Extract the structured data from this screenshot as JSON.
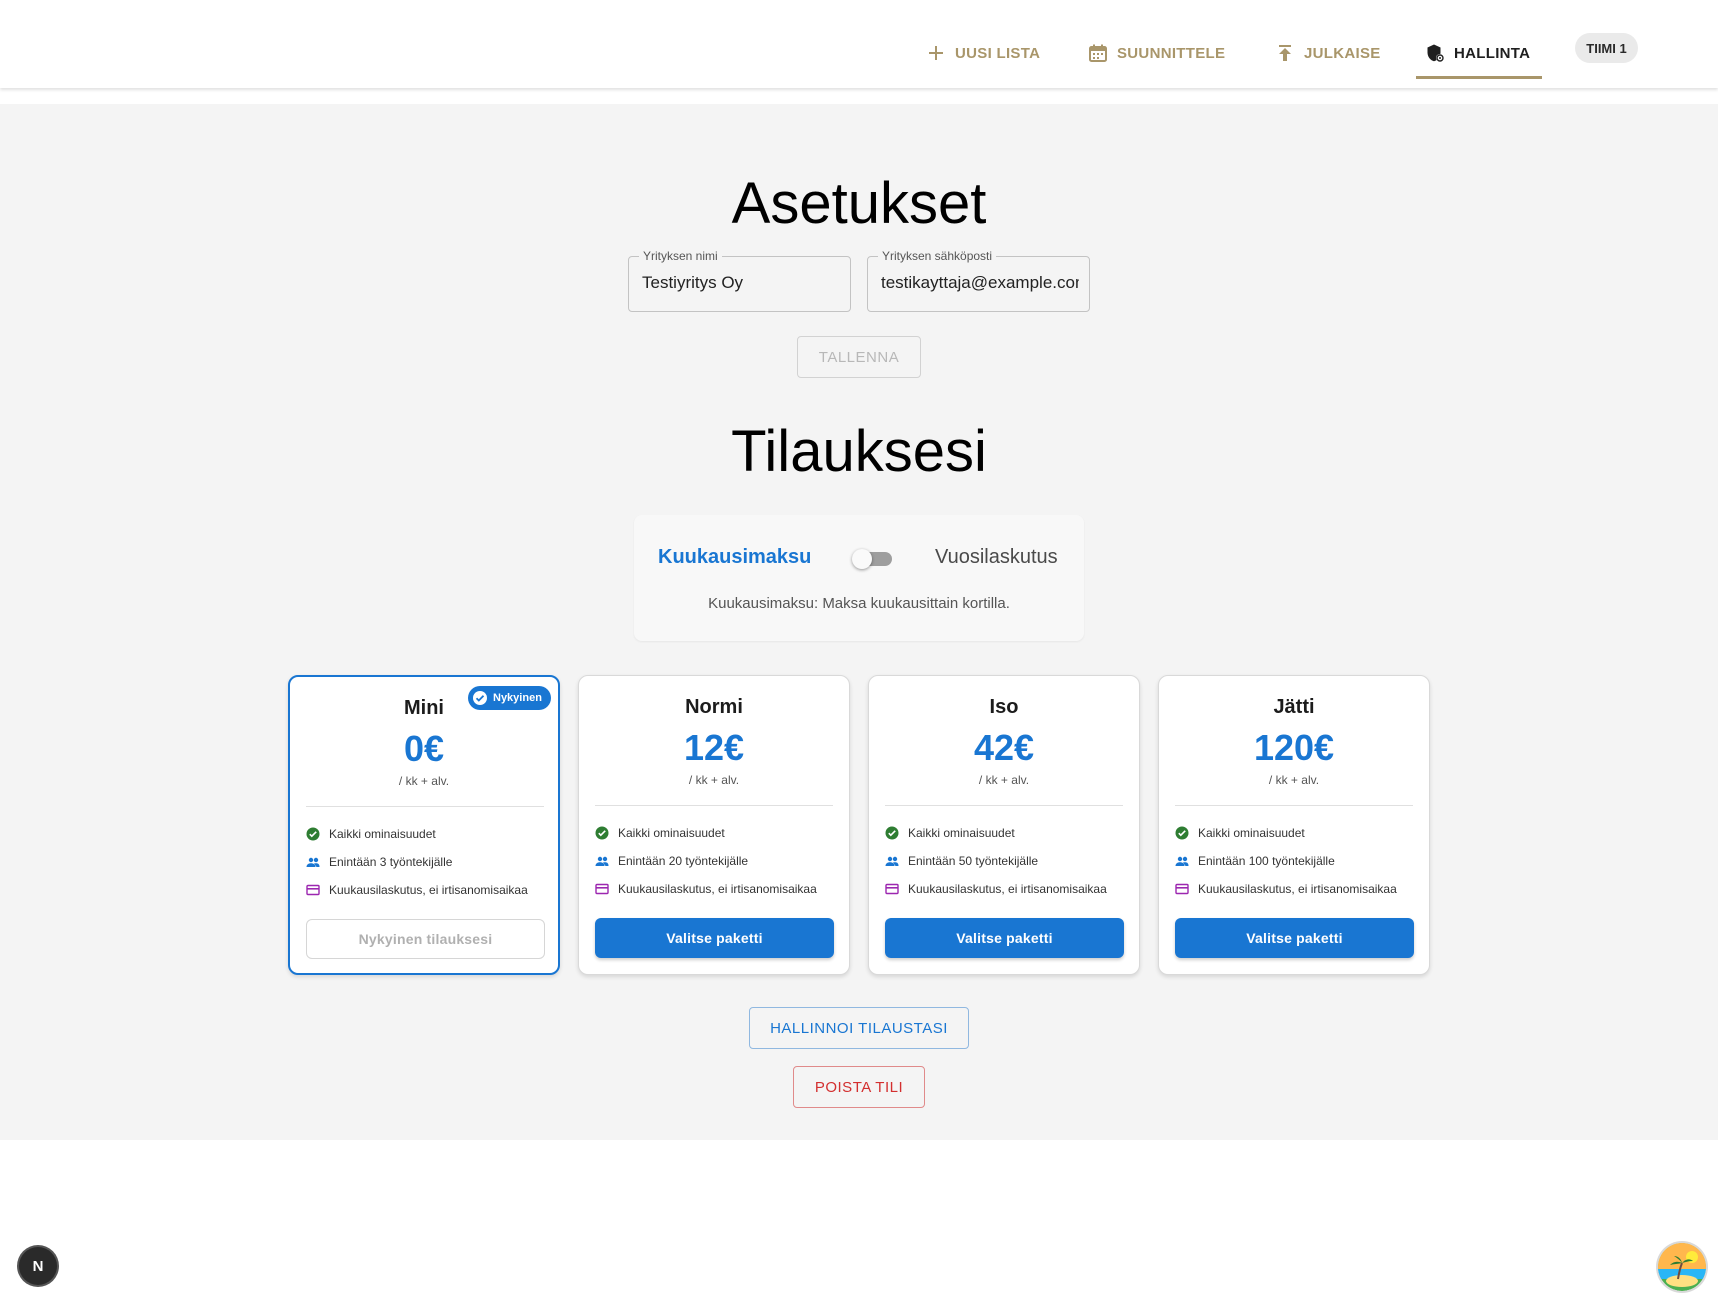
{
  "header": {
    "nav": [
      {
        "label": "UUSI LISTA",
        "icon": "plus-icon"
      },
      {
        "label": "SUUNNITTELE",
        "icon": "calendar-icon"
      },
      {
        "label": "JULKAISE",
        "icon": "publish-icon"
      },
      {
        "label": "HALLINTA",
        "icon": "admin-shield-icon",
        "active": true
      }
    ],
    "team_label": "TIIMI 1"
  },
  "settings": {
    "title": "Asetukset",
    "company_name": {
      "label": "Yrityksen nimi",
      "value": "Testiyritys Oy"
    },
    "company_email": {
      "label": "Yrityksen sähköposti",
      "value": "testikayttaja@example.com"
    },
    "save_label": "TALLENNA"
  },
  "subscription": {
    "title": "Tilauksesi",
    "billing": {
      "monthly_label": "Kuukausimaksu",
      "yearly_label": "Vuosilaskutus",
      "description": "Kuukausimaksu: Maksa kuukausittain kortilla.",
      "yearly_selected": false
    },
    "plans": [
      {
        "name": "Mini",
        "price": "0€",
        "per": "/ kk + alv.",
        "current": true,
        "badge": "Nykyinen",
        "features": [
          "Kaikki ominaisuudet",
          "Enintään 3 työntekijälle",
          "Kuukausilaskutus, ei irtisanomisaikaa"
        ],
        "button": "Nykyinen tilauksesi"
      },
      {
        "name": "Normi",
        "price": "12€",
        "per": "/ kk + alv.",
        "current": false,
        "features": [
          "Kaikki ominaisuudet",
          "Enintään 20 työntekijälle",
          "Kuukausilaskutus, ei irtisanomisaikaa"
        ],
        "button": "Valitse paketti"
      },
      {
        "name": "Iso",
        "price": "42€",
        "per": "/ kk + alv.",
        "current": false,
        "features": [
          "Kaikki ominaisuudet",
          "Enintään 50 työntekijälle",
          "Kuukausilaskutus, ei irtisanomisaikaa"
        ],
        "button": "Valitse paketti"
      },
      {
        "name": "Jätti",
        "price": "120€",
        "per": "/ kk + alv.",
        "current": false,
        "features": [
          "Kaikki ominaisuudet",
          "Enintään 100 työntekijälle",
          "Kuukausilaskutus, ei irtisanomisaikaa"
        ],
        "button": "Valitse paketti"
      }
    ],
    "manage_label": "HALLINNOI TILAUSTASI",
    "delete_label": "POISTA TILI"
  },
  "floating": {
    "dev_badge_letter": "N",
    "assistant_icon": "island-avatar-icon"
  },
  "colors": {
    "accent_gold": "#a9966a",
    "primary_blue": "#1976d2",
    "danger_red": "#d32f2f",
    "feature_check": "#2e7d32",
    "feature_people": "#1976d2",
    "feature_card": "#9c27b0"
  }
}
